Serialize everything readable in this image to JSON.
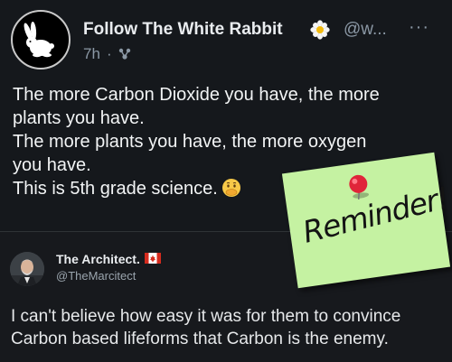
{
  "post": {
    "author": "Follow The White Rabbit",
    "handle": "@w...",
    "time": "7h",
    "separator": "·",
    "more": "···",
    "lines": [
      "The more Carbon Dioxide you have, the more",
      "plants you have.",
      "The more plants you have, the more oxygen",
      "you have.",
      "This is 5th grade science."
    ],
    "icons": {
      "avatar": "white-rabbit-icon",
      "badge": "flower-icon",
      "visibility": "threads-icon",
      "emoji": "face-with-hand-over-mouth-emoji"
    }
  },
  "reply": {
    "author": "The Architect.",
    "handle": "@TheMarcitect",
    "lines": [
      "I can't believe how easy it was for them to convince",
      "Carbon based lifeforms that Carbon is the enemy."
    ],
    "icons": {
      "flag": "canada-flag-icon"
    }
  },
  "sticky_note": {
    "text": "Reminder!",
    "color": "#c5f2a2",
    "pin_color": "#e0253a"
  },
  "colors": {
    "background": "#15181c",
    "text": "#f2f4f5",
    "muted": "#8b98a5"
  }
}
